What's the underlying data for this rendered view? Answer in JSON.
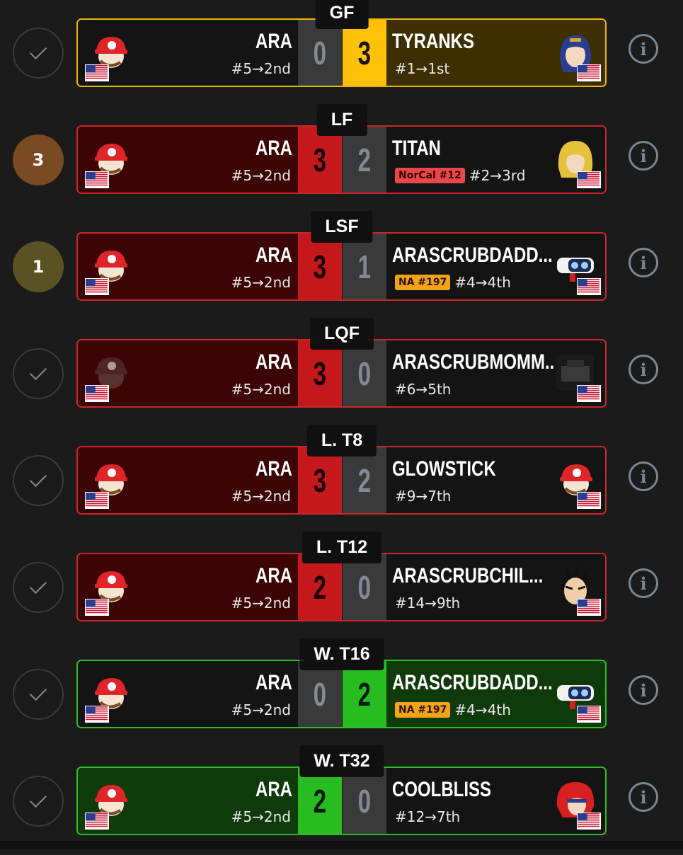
{
  "rounds": [
    {
      "round": "GF",
      "status": {
        "type": "check",
        "text": ""
      },
      "card": "win-gold",
      "left": {
        "name": "ARA",
        "seed": "#5→2nd",
        "score": "0",
        "score_style": "s-grey",
        "bg": "dark",
        "char": "red"
      },
      "right": {
        "name": "TYRANKS",
        "seed": "#1→1st",
        "badge": "",
        "badge_color": "",
        "score": "3",
        "score_style": "s-gold",
        "bg": "gold",
        "char": "blue-hair"
      }
    },
    {
      "round": "LF",
      "status": {
        "type": "num",
        "text": "3",
        "color": "#7a4a22"
      },
      "card": "lose",
      "left": {
        "name": "ARA",
        "seed": "#5→2nd",
        "score": "3",
        "score_style": "s-red",
        "bg": "red",
        "char": "red"
      },
      "right": {
        "name": "TITAN",
        "seed": "#2→3rd",
        "badge": "NorCal #12",
        "badge_color": "red",
        "score": "2",
        "score_style": "s-grey",
        "bg": "dark",
        "char": "blonde"
      }
    },
    {
      "round": "LSF",
      "status": {
        "type": "num",
        "text": "1",
        "color": "#5b5223"
      },
      "card": "lose",
      "left": {
        "name": "ARA",
        "seed": "#5→2nd",
        "score": "3",
        "score_style": "s-red",
        "bg": "red",
        "char": "red"
      },
      "right": {
        "name": "ARASCRUBDADD...",
        "seed": "#4→4th",
        "badge": "NA #197",
        "badge_color": "orange",
        "score": "1",
        "score_style": "s-grey",
        "bg": "dark",
        "char": "robot"
      }
    },
    {
      "round": "LQF",
      "status": {
        "type": "check",
        "text": ""
      },
      "card": "lose",
      "left": {
        "name": "ARA",
        "seed": "#5→2nd",
        "score": "3",
        "score_style": "s-red",
        "bg": "red",
        "char": "shadow"
      },
      "right": {
        "name": "ARASCRUBMOMM...",
        "seed": "#6→5th",
        "badge": "",
        "badge_color": "",
        "score": "0",
        "score_style": "s-grey",
        "bg": "dark",
        "char": "block"
      }
    },
    {
      "round": "L. T8",
      "status": {
        "type": "check",
        "text": ""
      },
      "card": "lose",
      "left": {
        "name": "ARA",
        "seed": "#5→2nd",
        "score": "3",
        "score_style": "s-red",
        "bg": "red",
        "char": "red"
      },
      "right": {
        "name": "GLOWSTICK",
        "seed": "#9→7th",
        "badge": "",
        "badge_color": "",
        "score": "2",
        "score_style": "s-grey",
        "bg": "dark",
        "char": "red"
      }
    },
    {
      "round": "L. T12",
      "status": {
        "type": "check",
        "text": ""
      },
      "card": "lose",
      "left": {
        "name": "ARA",
        "seed": "#5→2nd",
        "score": "2",
        "score_style": "s-red",
        "bg": "red",
        "char": "red"
      },
      "right": {
        "name": "ARASCRUBCHIL...",
        "seed": "#14→9th",
        "badge": "",
        "badge_color": "",
        "score": "0",
        "score_style": "s-grey",
        "bg": "dark",
        "char": "kazuya"
      }
    },
    {
      "round": "W. T16",
      "status": {
        "type": "check",
        "text": ""
      },
      "card": "win-green",
      "left": {
        "name": "ARA",
        "seed": "#5→2nd",
        "score": "0",
        "score_style": "s-grey",
        "bg": "dark",
        "char": "red"
      },
      "right": {
        "name": "ARASCRUBDADD...",
        "seed": "#4→4th",
        "badge": "NA #197",
        "badge_color": "orange",
        "score": "2",
        "score_style": "s-green",
        "bg": "green",
        "char": "robot"
      }
    },
    {
      "round": "W. T32",
      "status": {
        "type": "check",
        "text": ""
      },
      "card": "win-green",
      "left": {
        "name": "ARA",
        "seed": "#5→2nd",
        "score": "2",
        "score_style": "s-green",
        "bg": "green",
        "char": "red"
      },
      "right": {
        "name": "COOLBLISS",
        "seed": "#12→7th",
        "badge": "",
        "badge_color": "",
        "score": "0",
        "score_style": "s-grey",
        "bg": "dark",
        "char": "roy"
      }
    }
  ],
  "info_icon_label": "i",
  "colors": {
    "lose": "#c8272b",
    "win_gold": "#f0b400",
    "win_green": "#2bbf26"
  }
}
